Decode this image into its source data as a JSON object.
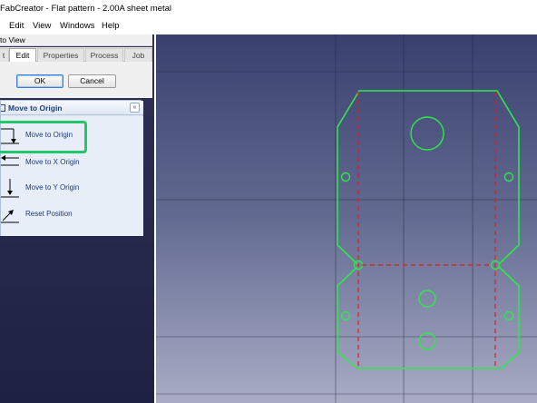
{
  "window": {
    "title": "FabCreator - Flat pattern - 2.00A sheet metal"
  },
  "menu": {
    "items": [
      "Edit",
      "View",
      "Windows",
      "Help"
    ]
  },
  "panel": {
    "header": "to View",
    "tabs": [
      {
        "label": "t",
        "active": false
      },
      {
        "label": "Edit",
        "active": true
      },
      {
        "label": "Properties",
        "active": false
      },
      {
        "label": "Process",
        "active": false
      },
      {
        "label": "Job",
        "active": false
      }
    ],
    "ok_label": "OK",
    "cancel_label": "Cancel"
  },
  "taskbox": {
    "title": "Move to Origin",
    "collapse_glyph": "«",
    "items": [
      {
        "label": "Move to Origin",
        "icon": "move-to-origin-icon",
        "selected": true
      },
      {
        "label": "Move to X Origin",
        "icon": "move-to-x-origin-icon",
        "selected": false
      },
      {
        "label": "Move to Y Origin",
        "icon": "move-to-y-origin-icon",
        "selected": false
      },
      {
        "label": "Reset Position",
        "icon": "reset-position-icon",
        "selected": false
      }
    ]
  },
  "colors": {
    "selection_highlight": "#22c76a",
    "part_outline": "#2ee84a",
    "bend_lines": "#e21b1b",
    "grid": "#1a1d33"
  }
}
